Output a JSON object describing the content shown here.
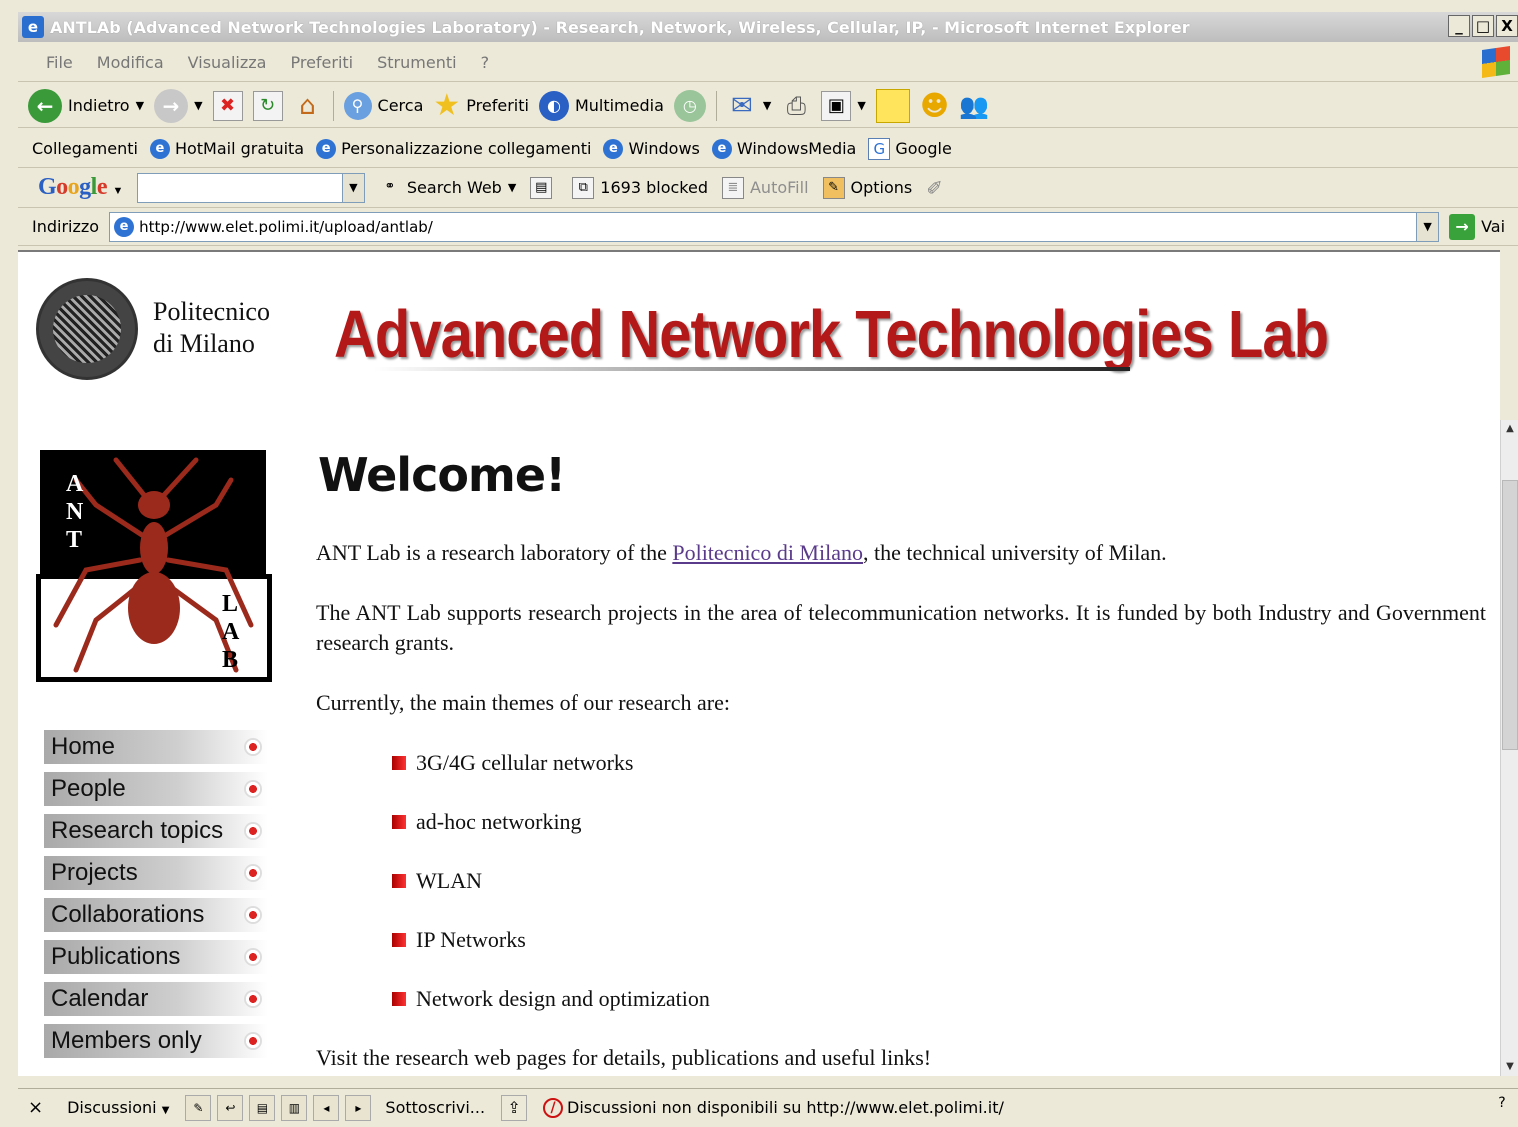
{
  "window": {
    "title": "ANTLAb (Advanced Network Technologies Laboratory) - Research, Network, Wireless, Cellular, IP, - Microsoft Internet Explorer",
    "buttons": [
      "_",
      "□",
      "X"
    ]
  },
  "menu": [
    "File",
    "Modifica",
    "Visualizza",
    "Preferiti",
    "Strumenti",
    "?"
  ],
  "toolbar": {
    "back": "Indietro",
    "search": "Cerca",
    "favorites": "Preferiti",
    "media": "Multimedia"
  },
  "links": {
    "label": "Collegamenti",
    "items": [
      "HotMail gratuita",
      "Personalizzazione collegamenti",
      "Windows",
      "WindowsMedia",
      "Google"
    ]
  },
  "googlebar": {
    "logo": [
      "G",
      "o",
      "o",
      "g",
      "l",
      "e"
    ],
    "search_value": "",
    "search_web": "Search Web",
    "blocked": "1693 blocked",
    "autofill": "AutoFill",
    "options": "Options"
  },
  "address": {
    "label": "Indirizzo",
    "url": "http://www.elet.polimi.it/upload/antlab/",
    "go": "Vai"
  },
  "page": {
    "institution_line1": "Politecnico",
    "institution_line2": "di Milano",
    "banner": "Advanced Network Technologies Lab",
    "logo_left": [
      "A",
      "N",
      "T"
    ],
    "logo_right": [
      "L",
      "A",
      "B"
    ],
    "nav": [
      "Home",
      "People",
      "Research topics",
      "Projects",
      "Collaborations",
      "Publications",
      "Calendar",
      "Members only"
    ],
    "welcome": "Welcome!",
    "intro_before": "ANT Lab is a research laboratory of the ",
    "intro_link": "Politecnico di Milano",
    "intro_after": ", the technical university of Milan.",
    "para2": "The ANT Lab supports research projects in the area of telecommunication networks. It is funded by both Industry and Government research grants.",
    "para3": "Currently, the main themes of our research are:",
    "themes": [
      "3G/4G cellular networks",
      "ad-hoc networking",
      "WLAN",
      "IP Networks",
      "Network design and optimization"
    ],
    "visit": "Visit the research web pages for details, publications and useful links!"
  },
  "statusbar": {
    "close": "×",
    "discussions": "Discussioni",
    "subscribe": "Sottoscrivi...",
    "message": "Discussioni non disponibili su http://www.elet.polimi.it/"
  },
  "colors": {
    "banner_red": "#b41919",
    "link_purple": "#5a3a8a"
  }
}
